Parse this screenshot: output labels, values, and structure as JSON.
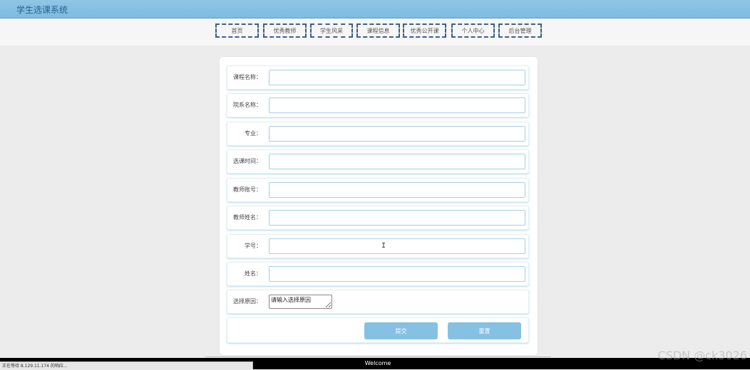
{
  "app": {
    "title": "学生选课系统"
  },
  "nav": {
    "items": [
      {
        "label": "首页"
      },
      {
        "label": "优秀教师"
      },
      {
        "label": "学生风采"
      },
      {
        "label": "课程信息"
      },
      {
        "label": "优秀公开课"
      },
      {
        "label": "个人中心"
      },
      {
        "label": "后台管理"
      }
    ]
  },
  "form": {
    "fields": [
      {
        "label": "课程名称：",
        "value": "",
        "placeholder": ""
      },
      {
        "label": "院系名称：",
        "value": "",
        "placeholder": ""
      },
      {
        "label": "专业：",
        "value": "",
        "placeholder": ""
      },
      {
        "label": "选课时间：",
        "value": "",
        "placeholder": ""
      },
      {
        "label": "教师账号：",
        "value": "",
        "placeholder": ""
      },
      {
        "label": "教师姓名：",
        "value": "",
        "placeholder": ""
      },
      {
        "label": "学号：",
        "value": "",
        "placeholder": ""
      },
      {
        "label": "姓名：",
        "value": "",
        "placeholder": ""
      }
    ],
    "reason": {
      "label": "选择原因：",
      "placeholder": "请输入选择原因"
    },
    "submit_label": "提交",
    "reset_label": "重置"
  },
  "footer": {
    "welcome": "Welcome",
    "status": "正在等待 8.129.11.174 的响应..."
  },
  "watermark": "CSDN @ck3026",
  "colors": {
    "accent": "#86c1e3",
    "nav_border": "#3f5f86",
    "topbar": "#8ec6e6"
  }
}
